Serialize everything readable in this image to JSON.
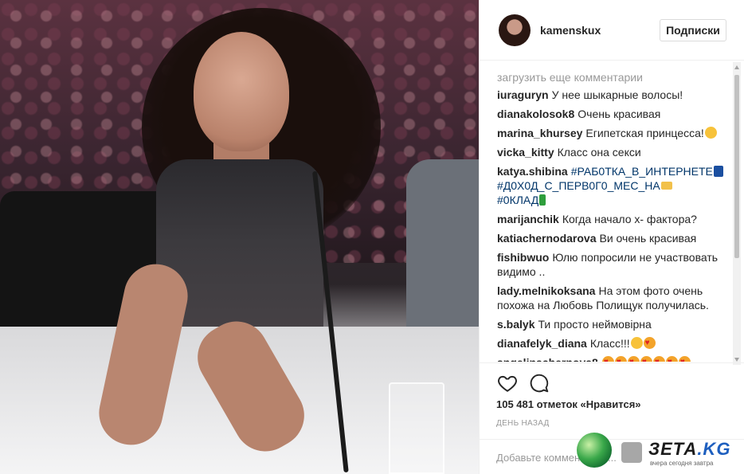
{
  "post": {
    "image_alt": "photo"
  },
  "header": {
    "username": "kamenskux",
    "follow_label": "Подписки"
  },
  "comments": {
    "load_more": "загрузить еще комментарии",
    "items": [
      {
        "user": "iuraguryn",
        "text": "У нее шыкарные волосы!"
      },
      {
        "user": "dianakolosok8",
        "text": "Очень красивая"
      },
      {
        "user": "marina_khursey",
        "text": "Египетская принцесса!"
      },
      {
        "user": "vicka_kitty",
        "text": "Класс она секси"
      },
      {
        "user": "katya.shibina",
        "tag1": "#РАБ0ТКА_В_ИНТЕРНЕТЕ",
        "tag2": "#Д0Х0Д_С_ПЕРВ0Г0_МЕС_НА",
        "tag3": "#0КЛАД"
      },
      {
        "user": "marijanchik",
        "text": "Когда начало х- фактора?"
      },
      {
        "user": "katiachernodarova",
        "text": "Ви очень красивая"
      },
      {
        "user": "fishibwuo",
        "text": "Юлю попросили не участвовать видимо .."
      },
      {
        "user": "lady.melnikoksana",
        "text": "На этом фото очень похожа на Любовь Полищук получилась."
      },
      {
        "user": "s.balyk",
        "text": "Ти просто неймовірна"
      },
      {
        "user": "dianafelyk_diana",
        "text": "Класс!!!"
      },
      {
        "user": "angelinachernova8",
        "text": ""
      }
    ]
  },
  "actions": {
    "like_icon": "heart-outline-icon",
    "comment_icon": "speech-bubble-icon"
  },
  "likes_text": "105 481 отметок «Нравится»",
  "time_text": "ДЕНЬ НАЗАД",
  "add_comment_placeholder": "Добавьте комментарий...",
  "watermark": {
    "brand": "ЗЕТА",
    "tld": ".KG",
    "tagline": "вчера сегодня завтра"
  },
  "colors": {
    "hashtag": "#003569",
    "muted": "#999999",
    "text": "#262626",
    "border": "#efefef"
  }
}
